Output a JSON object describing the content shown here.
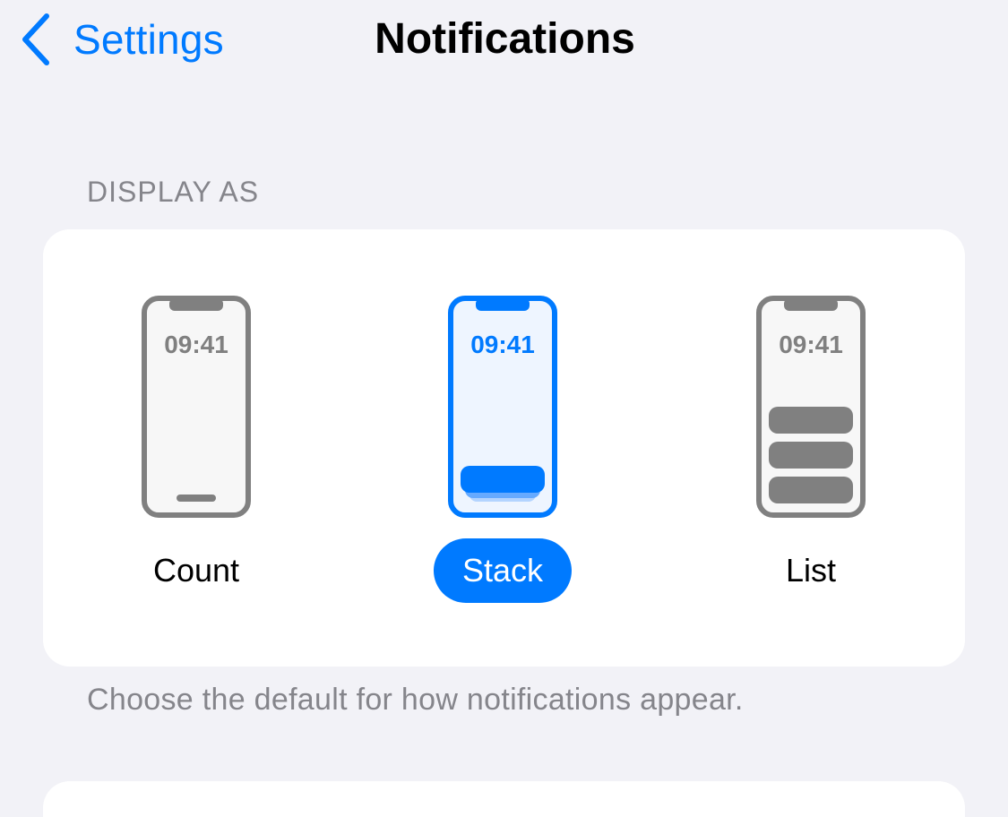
{
  "nav": {
    "back_label": "Settings",
    "title": "Notifications"
  },
  "display_as": {
    "header": "DISPLAY AS",
    "options": [
      {
        "label": "Count",
        "time": "09:41",
        "selected": false,
        "icon": "phone-count-icon"
      },
      {
        "label": "Stack",
        "time": "09:41",
        "selected": true,
        "icon": "phone-stack-icon"
      },
      {
        "label": "List",
        "time": "09:41",
        "selected": false,
        "icon": "phone-list-icon"
      }
    ],
    "footer": "Choose the default for how notifications appear."
  },
  "colors": {
    "accent": "#007aff",
    "background": "#f2f2f7",
    "card": "#ffffff",
    "secondary_text": "#85858b",
    "phone_gray": "#808080"
  }
}
